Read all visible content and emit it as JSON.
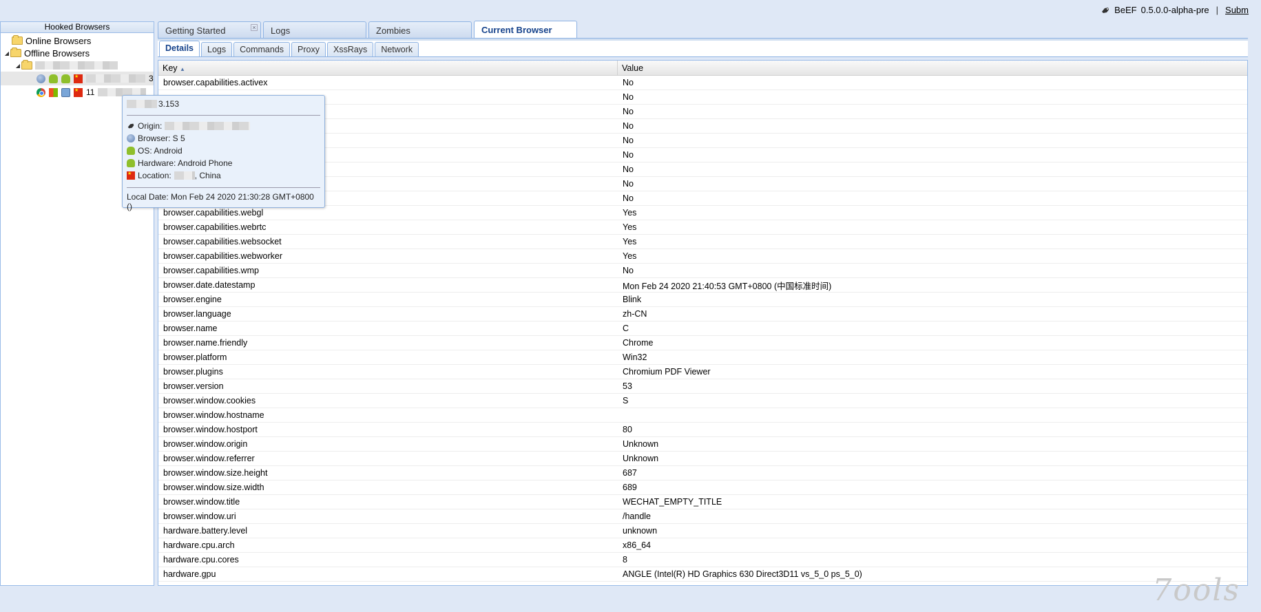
{
  "brand": {
    "name": "BeEF",
    "version": "0.5.0.0-alpha-pre",
    "separator": "|",
    "submit_label": "Subm"
  },
  "tree": {
    "header": "Hooked Browsers",
    "online_label": "Online Browsers",
    "offline_label": "Offline Browsers",
    "hooked_1_suffix": "3",
    "hooked_2_prefix": "11"
  },
  "tooltip": {
    "ip_suffix": "3.153",
    "origin_label": "Origin:",
    "browser_label": "Browser: S 5",
    "os_label": "OS: Android",
    "hardware_label": "Hardware: Android Phone",
    "location_label": "Location:",
    "location_country": ", China",
    "local_date": "Local Date: Mon Feb 24 2020 21:30:28 GMT+0800",
    "local_date_tail": "()"
  },
  "tabs": {
    "main": [
      {
        "label": "Getting Started",
        "closable": true
      },
      {
        "label": "Logs"
      },
      {
        "label": "Zombies"
      },
      {
        "label": "Current Browser",
        "active": true
      }
    ],
    "sub": [
      {
        "label": "Details",
        "active": true
      },
      {
        "label": "Logs"
      },
      {
        "label": "Commands"
      },
      {
        "label": "Proxy"
      },
      {
        "label": "XssRays"
      },
      {
        "label": "Network"
      }
    ]
  },
  "grid": {
    "key_header": "Key",
    "value_header": "Value",
    "rows": [
      {
        "key": "browser.capabilities.activex",
        "value": "No"
      },
      {
        "key": "",
        "value": "No"
      },
      {
        "key": "",
        "value": "No"
      },
      {
        "key": "",
        "value": "No"
      },
      {
        "key": "",
        "value": "No"
      },
      {
        "key": "",
        "value": "No"
      },
      {
        "key": "",
        "value": "No"
      },
      {
        "key": "",
        "value": "No"
      },
      {
        "key": "",
        "value": "No"
      },
      {
        "key": "browser.capabilities.webgl",
        "value": "Yes"
      },
      {
        "key": "browser.capabilities.webrtc",
        "value": "Yes"
      },
      {
        "key": "browser.capabilities.websocket",
        "value": "Yes"
      },
      {
        "key": "browser.capabilities.webworker",
        "value": "Yes"
      },
      {
        "key": "browser.capabilities.wmp",
        "value": "No"
      },
      {
        "key": "browser.date.datestamp",
        "value": "Mon Feb 24 2020 21:40:53 GMT+0800 (中国标准时间)"
      },
      {
        "key": "browser.engine",
        "value": "Blink"
      },
      {
        "key": "browser.language",
        "value": "zh-CN"
      },
      {
        "key": "browser.name",
        "value": "C"
      },
      {
        "key": "browser.name.friendly",
        "value": "Chrome"
      },
      {
        "key": "browser.platform",
        "value": "Win32"
      },
      {
        "key": "browser.plugins",
        "value": "Chromium PDF Viewer"
      },
      {
        "key": "browser.version",
        "value": "53"
      },
      {
        "key": "browser.window.cookies",
        "value": "S"
      },
      {
        "key": "browser.window.hostname",
        "value": ""
      },
      {
        "key": "browser.window.hostport",
        "value": "80"
      },
      {
        "key": "browser.window.origin",
        "value": "Unknown"
      },
      {
        "key": "browser.window.referrer",
        "value": "Unknown"
      },
      {
        "key": "browser.window.size.height",
        "value": "687"
      },
      {
        "key": "browser.window.size.width",
        "value": "689"
      },
      {
        "key": "browser.window.title",
        "value": "WECHAT_EMPTY_TITLE"
      },
      {
        "key": "browser.window.uri",
        "value": "/handle"
      },
      {
        "key": "hardware.battery.level",
        "value": "unknown"
      },
      {
        "key": "hardware.cpu.arch",
        "value": "x86_64"
      },
      {
        "key": "hardware.cpu.cores",
        "value": "8"
      },
      {
        "key": "hardware.gpu",
        "value": "ANGLE (Intel(R) HD Graphics 630 Direct3D11 vs_5_0 ps_5_0)"
      }
    ]
  },
  "watermark": "7ools"
}
